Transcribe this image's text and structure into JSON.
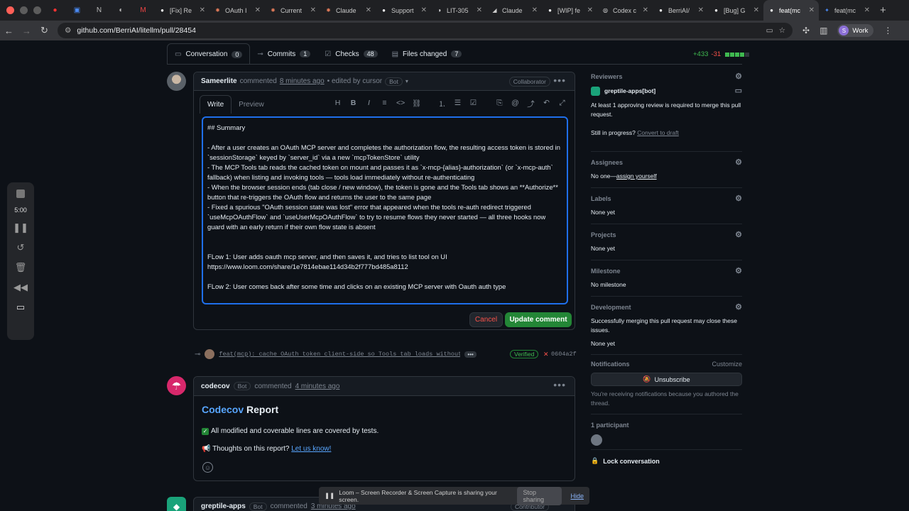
{
  "browser": {
    "tabs": [
      {
        "title": "[Fix] Re",
        "icon": "github-icon",
        "active": false
      },
      {
        "title": "OAuth I",
        "icon": "claude-icon",
        "active": false
      },
      {
        "title": "Current",
        "icon": "claude-icon",
        "active": false
      },
      {
        "title": "Claude",
        "icon": "claude-icon",
        "active": false
      },
      {
        "title": "Support",
        "icon": "github-icon",
        "active": false
      },
      {
        "title": "LIT-305",
        "icon": "linear-icon",
        "active": false
      },
      {
        "title": "Claude",
        "icon": "bird-icon",
        "active": false
      },
      {
        "title": "[WIP] fe",
        "icon": "github-icon",
        "active": false
      },
      {
        "title": "Codex c",
        "icon": "codex-icon",
        "active": false
      },
      {
        "title": "BerriAI/",
        "icon": "github-icon",
        "active": false
      },
      {
        "title": "[Bug] G",
        "icon": "github-icon",
        "active": false
      },
      {
        "title": "feat(mc",
        "icon": "github-icon",
        "active": true
      },
      {
        "title": "feat(mc",
        "icon": "puzzle-icon",
        "active": false
      }
    ],
    "url": "github.com/BerriAI/litellm/pull/28454",
    "profile": {
      "initial": "S",
      "name": "Work"
    }
  },
  "pr_tabs": [
    {
      "label": "Conversation",
      "count": "0",
      "icon": "conversation-icon"
    },
    {
      "label": "Commits",
      "count": "1",
      "icon": "commit-icon"
    },
    {
      "label": "Checks",
      "count": "48",
      "icon": "checks-icon"
    },
    {
      "label": "Files changed",
      "count": "7",
      "icon": "files-icon"
    }
  ],
  "diffstat": {
    "additions": "+433",
    "deletions": "-31"
  },
  "loom_controls": {
    "time": "5:00"
  },
  "edit_comment": {
    "author": "Sameerlite",
    "action": "commented",
    "time": "8 minutes ago",
    "edited": "• edited by cursor",
    "bot_badge": "Bot",
    "role_badge": "Collaborator",
    "write_tab": "Write",
    "preview_tab": "Preview",
    "body": "## Summary\n\n- After a user creates an OAuth MCP server and completes the authorization flow, the resulting access token is stored in `sessionStorage` keyed by `server_id` via a new `mcpTokenStore` utility\n- The MCP Tools tab reads the cached token on mount and passes it as `x-mcp-{alias}-authorization` (or `x-mcp-auth` fallback) when listing and invoking tools — tools load immediately without re-authenticating\n- When the browser session ends (tab close / new window), the token is gone and the Tools tab shows an **Authorize** button that re-triggers the OAuth flow and returns the user to the same page\n- Fixed a spurious \"OAuth session state was lost\" error that appeared when the tools re-auth redirect triggered `useMcpOAuthFlow` and `useUserMcpOAuthFlow` to try to resume flows they never started — all three hooks now guard with an early return if their own flow state is absent\n\n\nFLow 1: User adds oauth mcp server, and then saves it, and tries to list tool on UI\nhttps://www.loom.com/share/1e7814ebae114d34b2f777bd485a8112\n\nFLow 2: User comes back after some time and clicks on an existing MCP server with Oauth auth type",
    "cancel_label": "Cancel",
    "update_label": "Update comment"
  },
  "commit": {
    "message": "feat(mcp): cache OAuth token client-side so Tools tab loads without r…",
    "ellipsis": "•••",
    "verified": "Verified",
    "sha": "0604a2f"
  },
  "codecov_comment": {
    "author": "codecov",
    "bot_badge": "Bot",
    "action": "commented",
    "time": "4 minutes ago",
    "title_brand": "Codecov",
    "title_rest": " Report",
    "line1": "All modified and coverable lines are covered by tests.",
    "line2_prefix": "Thoughts on this report? ",
    "line2_link": "Let us know!"
  },
  "greptile_comment": {
    "author": "greptile-apps",
    "bot_badge": "Bot",
    "action": "commented",
    "time": "3 minutes ago",
    "role_badge": "Contributor"
  },
  "sharing_bar": {
    "text": "Loom – Screen Recorder & Screen Capture is sharing your screen.",
    "stop_label": "Stop sharing",
    "hide_label": "Hide"
  },
  "sidebar": {
    "reviewers": {
      "title": "Reviewers",
      "reviewer": "greptile-apps[bot]",
      "note": "At least 1 approving review is required to merge this pull request.",
      "progress_prefix": "Still in progress? ",
      "progress_link": "Convert to draft"
    },
    "assignees": {
      "title": "Assignees",
      "value_prefix": "No one—",
      "value_link": "assign yourself"
    },
    "labels": {
      "title": "Labels",
      "value": "None yet"
    },
    "projects": {
      "title": "Projects",
      "value": "None yet"
    },
    "milestone": {
      "title": "Milestone",
      "value": "No milestone"
    },
    "development": {
      "title": "Development",
      "note": "Successfully merging this pull request may close these issues.",
      "value": "None yet"
    },
    "notifications": {
      "title": "Notifications",
      "customize": "Customize",
      "button": "Unsubscribe",
      "note": "You're receiving notifications because you authored the thread."
    },
    "participants": {
      "title": "1 participant"
    },
    "lock": {
      "label": "Lock conversation"
    }
  },
  "colors": {
    "accent_blue": "#1f6feb",
    "success_green": "#238636",
    "danger_red": "#f85149"
  }
}
